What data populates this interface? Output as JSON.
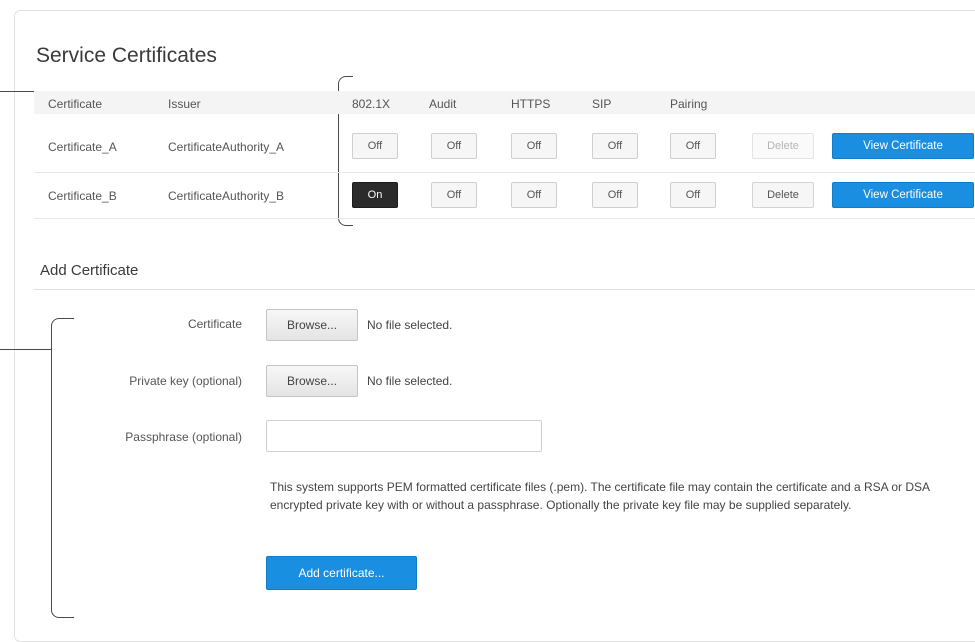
{
  "service": {
    "title": "Service Certificates",
    "columns": {
      "certificate": "Certificate",
      "issuer": "Issuer",
      "dot1x": "802.1X",
      "audit": "Audit",
      "https": "HTTPS",
      "sip": "SIP",
      "pairing": "Pairing"
    },
    "rows": [
      {
        "certificate": "Certificate_A",
        "issuer": "CertificateAuthority_A",
        "dot1x": "Off",
        "audit": "Off",
        "https": "Off",
        "sip": "Off",
        "pairing": "Off",
        "delete_label": "Delete",
        "delete_enabled": false,
        "view_label": "View Certificate"
      },
      {
        "certificate": "Certificate_B",
        "issuer": "CertificateAuthority_B",
        "dot1x": "On",
        "audit": "Off",
        "https": "Off",
        "sip": "Off",
        "pairing": "Off",
        "delete_label": "Delete",
        "delete_enabled": true,
        "view_label": "View Certificate"
      }
    ]
  },
  "add": {
    "title": "Add Certificate",
    "certificate_label": "Certificate",
    "private_key_label": "Private key (optional)",
    "passphrase_label": "Passphrase (optional)",
    "browse_label": "Browse...",
    "no_file_text": "No file selected.",
    "passphrase_value": "",
    "help_text": "This system supports PEM formatted certificate files (.pem). The certificate file may contain the certificate and a RSA or DSA encrypted private key with or without a passphrase. Optionally the private key file may be supplied separately.",
    "submit_label": "Add certificate..."
  },
  "colors": {
    "primary": "#1a8ee0",
    "on_state": "#2b2b2b"
  }
}
